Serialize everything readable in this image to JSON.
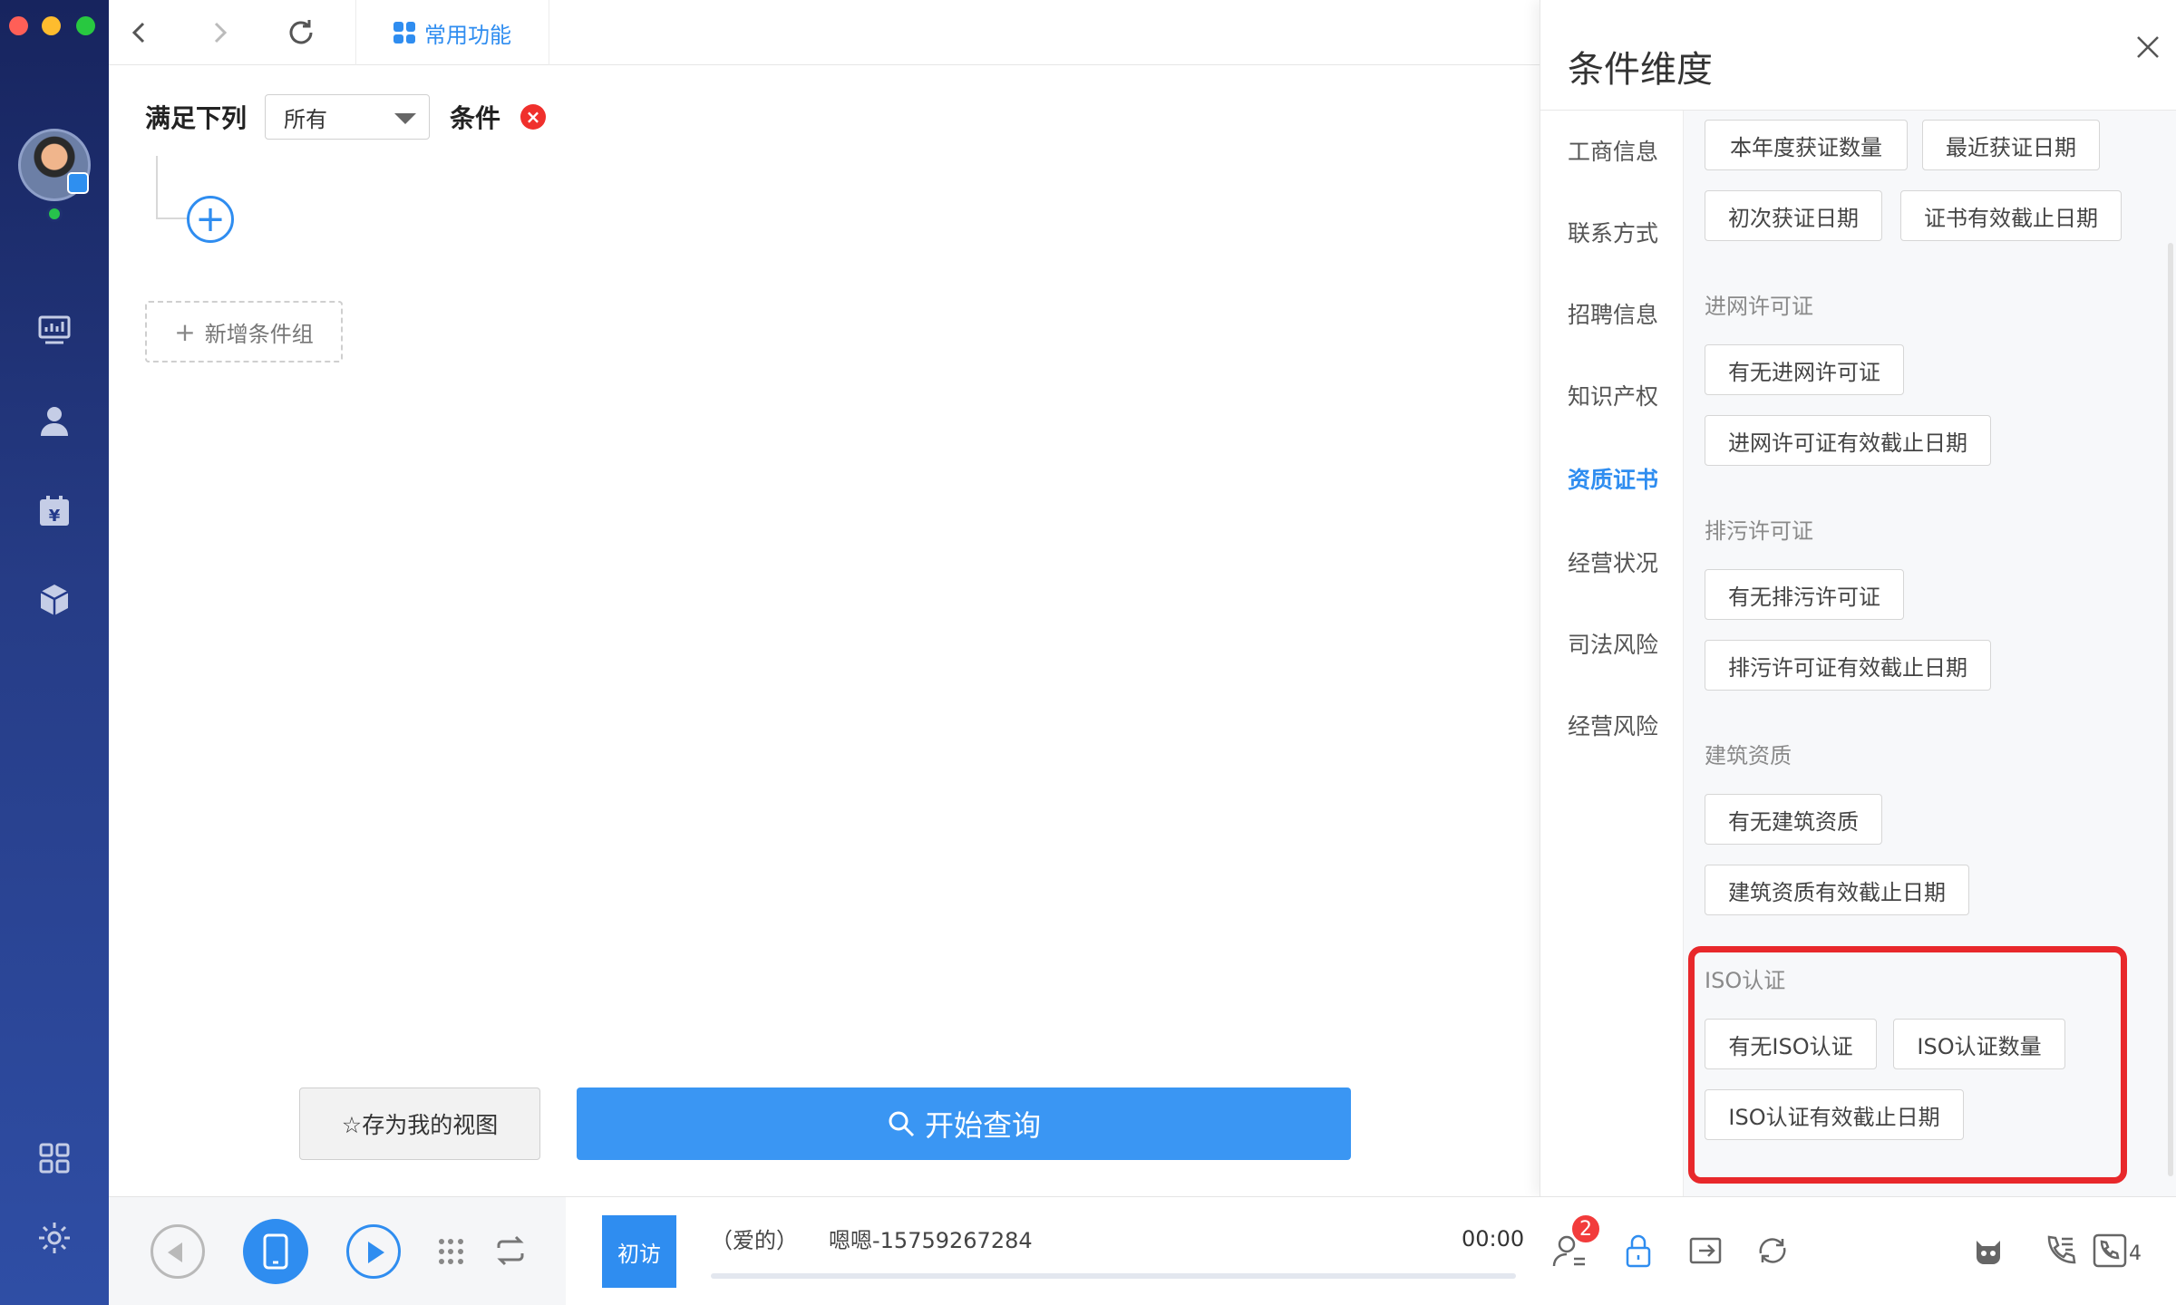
{
  "sidebar": {
    "window_controls": [
      {
        "name": "close",
        "color": "#ff5f57"
      },
      {
        "name": "minimize",
        "color": "#febc2e"
      },
      {
        "name": "maximize",
        "color": "#28c840"
      }
    ],
    "icons": [
      "dashboard-icon",
      "contacts-icon",
      "billing-calendar-icon",
      "product-cube-icon",
      "apps-grid-icon",
      "settings-gear-icon"
    ]
  },
  "toolbar": {
    "common_tab_label": "常用功能"
  },
  "condition": {
    "prefix_label": "满足下列",
    "match_select_value": "所有",
    "suffix_label": "条件",
    "add_group_label": "新增条件组"
  },
  "actions": {
    "save_view_label": "☆存为我的视图",
    "start_query_label": "开始查询"
  },
  "drawer": {
    "title": "条件维度",
    "nav_items": [
      "工商信息",
      "联系方式",
      "招聘信息",
      "知识产权",
      "资质证书",
      "经营状况",
      "司法风险",
      "经营风险"
    ],
    "active_nav": "资质证书",
    "top_chips": [
      "本年度获证数量",
      "最近获证日期",
      "初次获证日期",
      "证书有效截止日期"
    ],
    "sections": [
      {
        "title": "进网许可证",
        "chips": [
          "有无进网许可证",
          "进网许可证有效截止日期"
        ]
      },
      {
        "title": "排污许可证",
        "chips": [
          "有无排污许可证",
          "排污许可证有效截止日期"
        ]
      },
      {
        "title": "建筑资质",
        "chips": [
          "有无建筑资质",
          "建筑资质有效截止日期"
        ]
      },
      {
        "title": "ISO认证",
        "chips": [
          "有无ISO认证",
          "ISO认证数量",
          "ISO认证有效截止日期"
        ]
      }
    ]
  },
  "callbar": {
    "visit_tag": "初访",
    "contact_relation": "（爱的）",
    "contact_name_phone": "嗯嗯-15759267284",
    "call_time": "00:00",
    "notification_count": "2",
    "line_count": "4"
  },
  "colors": {
    "accent": "#2f8df0",
    "sidebar_top": "#17245e",
    "sidebar_bottom": "#2f4ea5",
    "danger": "#f0302c",
    "highlight": "#e8282b"
  }
}
